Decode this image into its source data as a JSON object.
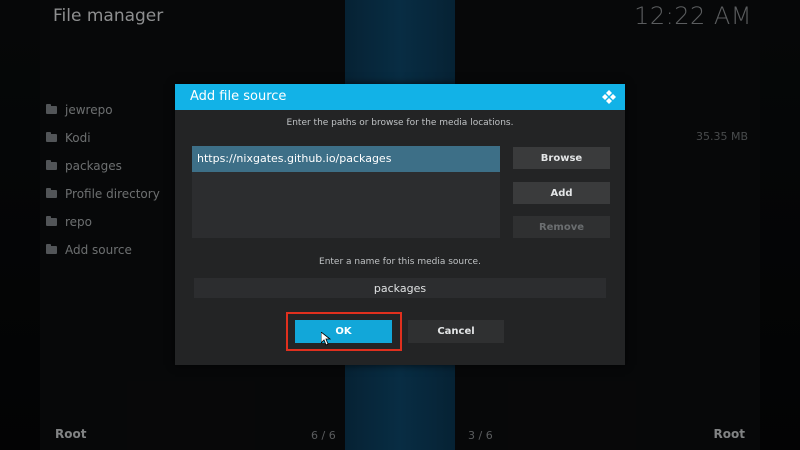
{
  "app": {
    "title": "File manager",
    "clock": "12:22 AM"
  },
  "left_list": [
    {
      "label": "jewrepo"
    },
    {
      "label": "Kodi"
    },
    {
      "label": "packages"
    },
    {
      "label": "Profile directory"
    },
    {
      "label": "repo"
    },
    {
      "label": "Add source"
    }
  ],
  "right_panel": {
    "size": "35.35 MB"
  },
  "footer": {
    "left": "Root",
    "left_count": "6 / 6",
    "right_count": "3 / 6",
    "right": "Root"
  },
  "dialog": {
    "title": "Add file source",
    "instruction_paths": "Enter the paths or browse for the media locations.",
    "paths": [
      "https://nixgates.github.io/packages"
    ],
    "browse_label": "Browse",
    "add_label": "Add",
    "remove_label": "Remove",
    "instruction_name": "Enter a name for this media source.",
    "name_value": "packages",
    "ok_label": "OK",
    "cancel_label": "Cancel"
  },
  "colors": {
    "accent": "#12b2e7",
    "highlight": "#e0301e",
    "selected_row": "#3d6f87"
  },
  "icons": {
    "folder": "folder-icon",
    "kodi_logo": "kodi-logo-icon",
    "cursor": "mouse-cursor-icon"
  }
}
